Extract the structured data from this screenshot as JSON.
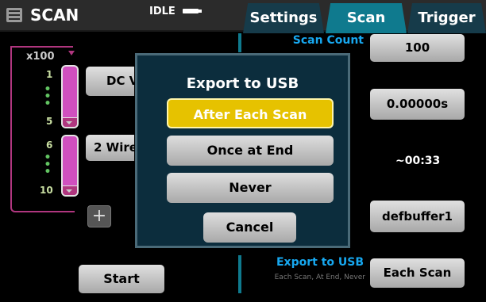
{
  "header": {
    "title": "SCAN",
    "status": "IDLE",
    "tabs": [
      {
        "label": "Settings",
        "active": false
      },
      {
        "label": "Scan",
        "active": true
      },
      {
        "label": "Trigger",
        "active": false
      }
    ]
  },
  "channels": {
    "multiplier": "x100",
    "group1": {
      "start": "1",
      "end": "5",
      "function": "DC V"
    },
    "group2": {
      "start": "6",
      "end": "10",
      "function": "2 Wire"
    },
    "add_label": "+"
  },
  "settings": {
    "scan_count_label": "Scan Count",
    "scan_count_value": "100",
    "interval_value": "0.00000s",
    "duration_value": "~00:33",
    "buffer_value": "defbuffer1",
    "export_label": "Export to USB",
    "export_sub": "Each Scan, At End, Never",
    "export_value": "Each Scan"
  },
  "start_label": "Start",
  "dialog": {
    "title": "Export to USB",
    "options": [
      "After Each Scan",
      "Once at End",
      "Never"
    ],
    "selected": "After Each Scan",
    "cancel_label": "Cancel"
  },
  "colors": {
    "accent_blue": "#17a8f0",
    "tab_active": "#0f7a8e",
    "channel_magenta": "#d050bf",
    "highlight_yellow": "#e6c200"
  }
}
